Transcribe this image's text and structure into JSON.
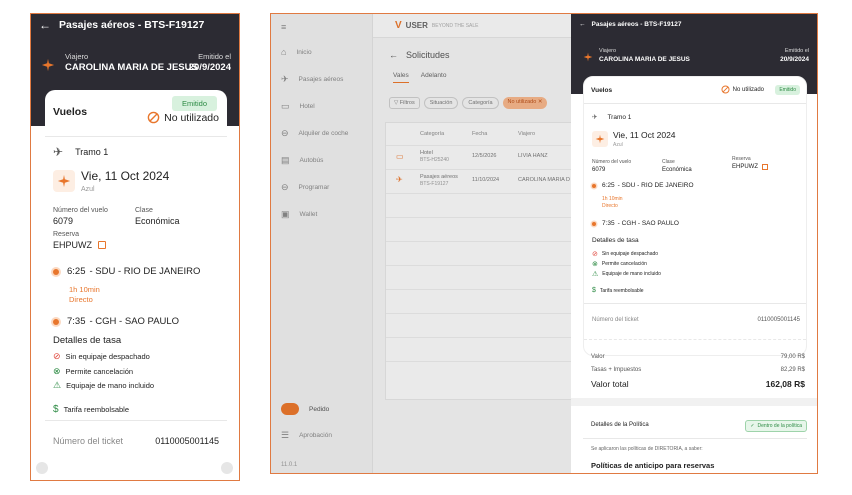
{
  "left": {
    "header_title": "Pasajes aéreos - BTS-F19127",
    "traveler_label": "Viajero",
    "traveler_name": "CAROLINA MARIA DE JESUS",
    "issued_label": "Emitido el",
    "issued_date": "20/9/2024",
    "section_title": "Vuelos",
    "status_badge": "Emitido",
    "usage_status": "No utilizado",
    "leg_label": "Tramo 1",
    "date": "Vie, 11 Oct 2024",
    "airline": "Azul",
    "flight_number_label": "Número del vuelo",
    "flight_number": "6079",
    "class_label": "Clase",
    "class_value": "Económica",
    "booking_label": "Reserva",
    "booking_code": "EHPUWZ",
    "dep_time": "6:25",
    "dep_place": "- SDU - RIO DE JANEIRO",
    "duration": "1h 10min",
    "stops": "Directo",
    "arr_time": "7:35",
    "arr_place": "- CGH - SAO PAULO",
    "fare_title": "Detalles de tasa",
    "fare_items": [
      "Sin equipaje despachado",
      "Permite cancelación",
      "Equipaje de mano incluido",
      "Tarifa reembolsable"
    ],
    "ticket_label": "Número del ticket",
    "ticket_number": "0110005001145"
  },
  "app": {
    "sidebar": [
      "Inicio",
      "Pasajes aéreos",
      "Hotel",
      "Alquiler de coche",
      "Autobús",
      "Programar",
      "Wallet"
    ],
    "sidebar_bottom": [
      "Pedido",
      "Aprobación"
    ],
    "version": "11.0.1",
    "logo_text": "USER",
    "logo_tagline": "BEYOND THE SALE",
    "page_title": "Solicitudes",
    "tabs": [
      "Vales",
      "Adelanto"
    ],
    "filters": [
      "Filtros",
      "Situación",
      "Categoría",
      "No utilizado"
    ],
    "columns": [
      "Categoría",
      "Fecha",
      "Viajero"
    ],
    "rows": [
      {
        "category": "Hotel",
        "code": "BTS-H25240",
        "date": "12/5/2026",
        "traveler": "LIVIA HANZ"
      },
      {
        "category": "Pasajes aéreos",
        "code": "BTS-F19127",
        "date": "11/10/2024",
        "traveler": "CAROLINA MARIA D"
      }
    ]
  },
  "detail": {
    "header_title": "Pasajes aéreos - BTS-F19127",
    "traveler_label": "Viajero",
    "traveler_name": "CAROLINA MARIA DE JESUS",
    "issued_label": "Emitido el",
    "issued_date": "20/9/2024",
    "section_title": "Vuelos",
    "usage_status": "No utilizado",
    "status_badge": "Emitido",
    "leg_label": "Tramo 1",
    "date": "Vie, 11 Oct 2024",
    "airline": "Azul",
    "flight_number_label": "Número del vuelo",
    "flight_number": "6079",
    "class_label": "Clase",
    "class_value": "Económica",
    "booking_label": "Reserva",
    "booking_code": "EHPUWZ",
    "dep_time": "6:25",
    "dep_place": "- SDU - RIO DE JANEIRO",
    "duration": "1h 10min",
    "stops": "Directo",
    "arr_time": "7:35",
    "arr_place": "- CGH - SAO PAULO",
    "fare_title": "Detalles de tasa",
    "fare_items": [
      "Sin equipaje despachado",
      "Permite cancelación",
      "Equipaje de mano incluido",
      "Tarifa reembolsable"
    ],
    "ticket_label": "Número del ticket",
    "ticket_number": "0110005001145",
    "value_label": "Valor",
    "value_amount": "79,00 R$",
    "taxes_label": "Tasas + Impuestos",
    "taxes_amount": "82,29 R$",
    "total_label": "Valor total",
    "total_amount": "162,08 R$",
    "policy_title": "Detalles de la Política",
    "policy_badge": "Dentro de la política",
    "policy_text": "Se aplicaron las políticas de DIRETORIA, a saber:",
    "policy_subtitle": "Políticas de anticipo para reservas"
  },
  "colors": {
    "accent": "#e8762c",
    "dark": "#2c2b33",
    "green_bg": "#d8f1de",
    "green": "#2d8b44",
    "red": "#e0483e"
  }
}
